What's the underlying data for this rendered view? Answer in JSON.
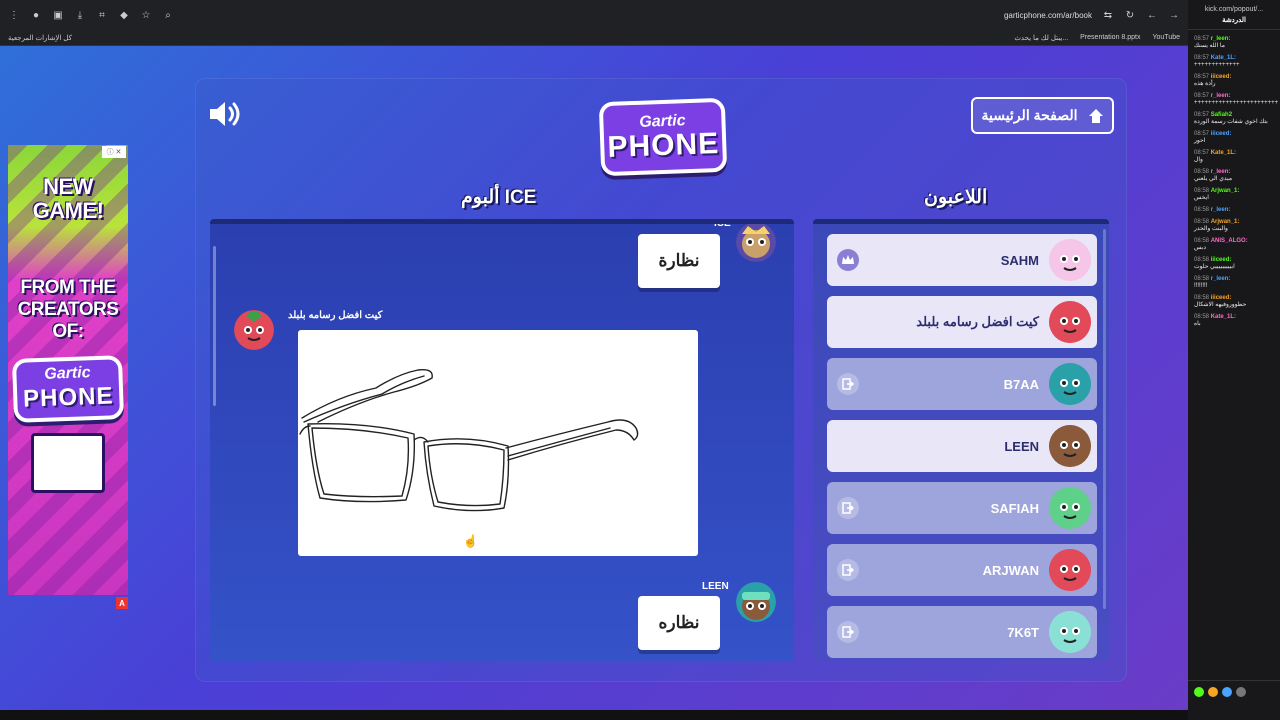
{
  "browser": {
    "url": "garticphone.com/ar/book",
    "bookmarks_left": "كل الإشارات المرجعية",
    "bookmarks_right": [
      "يبتل لك ما يحدث...",
      "Presentation 8.pptx",
      "YouTube"
    ]
  },
  "ad": {
    "line1": "NEW GAME!",
    "line2": "FROM THE CREATORS OF:",
    "logo_top": "Gartic",
    "logo_bottom": "PHONE",
    "close": "ⓘ ✕",
    "mark": "A"
  },
  "header": {
    "logo_top": "Gartic",
    "logo_bottom": "PHONE",
    "home_label": "الصفحة الرئيسية"
  },
  "album": {
    "title": "ألبوم ICE",
    "entries": [
      {
        "player": "ICE",
        "text": "نظارة"
      },
      {
        "player": "كيت افضل رسامه بلبلد",
        "drawing": "glasses"
      },
      {
        "player": "LEEN",
        "text": "نظاره"
      }
    ]
  },
  "players": {
    "title": "اللاعبون",
    "list": [
      {
        "name": "SAHM",
        "status": "host",
        "color": "#f5c6e8"
      },
      {
        "name": "كيت افضل رسامه بلبلد",
        "status": "online",
        "color": "#e24a5a"
      },
      {
        "name": "B7AA",
        "status": "left",
        "color": "#2aa1a8"
      },
      {
        "name": "LEEN",
        "status": "online",
        "color": "#8a5a3a"
      },
      {
        "name": "SAFIAH",
        "status": "left",
        "color": "#5fd08a"
      },
      {
        "name": "ARJWAN",
        "status": "left",
        "color": "#e24a5a"
      },
      {
        "name": "7K6T",
        "status": "left",
        "color": "#8ae0d4"
      }
    ]
  },
  "chat": {
    "url": "kick.com/popout/...",
    "title": "الدردشة",
    "messages": [
      {
        "time": "08:57",
        "user": "r_leen:",
        "text": "ما الله يسنك"
      },
      {
        "time": "08:57",
        "user": "Kate_1L:",
        "text": "+++++++++++++"
      },
      {
        "time": "08:57",
        "user": "iiiceed:",
        "text": "رأدة هذه"
      },
      {
        "time": "08:57",
        "user": "r_leen:",
        "text": "++++++++++++++++++++++++"
      },
      {
        "time": "08:57",
        "user": "Safiah2",
        "text": "بتك اخوي شفات رسمة الوردة"
      },
      {
        "time": "08:57",
        "user": "iiiceed:",
        "text": "احور"
      },
      {
        "time": "08:57",
        "user": "Kate_1L:",
        "text": "وال"
      },
      {
        "time": "08:58",
        "user": "r_leen:",
        "text": "ميدي الي يلعني"
      },
      {
        "time": "08:58",
        "user": "Arjwan_1:",
        "text": "ايخس"
      },
      {
        "time": "08:58",
        "user": "r_leen:",
        "text": ""
      },
      {
        "time": "08:58",
        "user": "Arjwan_1:",
        "text": "والبنت والحدر"
      },
      {
        "time": "08:58",
        "user": "ANIS_ALGO:",
        "text": "دبس"
      },
      {
        "time": "08:58",
        "user": "iiiceed:",
        "text": "ابيييييييييي حلوت"
      },
      {
        "time": "08:58",
        "user": "r_leen:",
        "text": "!!!!!!!!"
      },
      {
        "time": "08:58",
        "user": "iiiceed:",
        "text": "حطووروفيهه الاشكال"
      },
      {
        "time": "08:58",
        "user": "Kate_1L:",
        "text": "باه"
      }
    ]
  }
}
